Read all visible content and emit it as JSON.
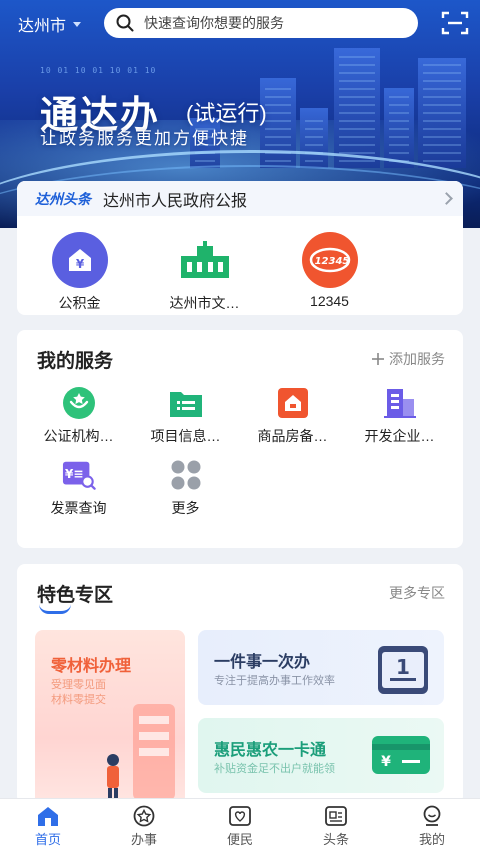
{
  "header": {
    "city": "达州市",
    "search_placeholder": "快速查询你想要的服务"
  },
  "banner": {
    "title": "通达办",
    "title_suffix": "(试运行)",
    "subtitle": "让政务服务更加方便快捷",
    "digits": "10 01 10 01 10 01 10"
  },
  "headline": {
    "tag": "达州头条",
    "text": "达州市人民政府公报"
  },
  "quick_items": [
    {
      "label": "公积金",
      "icon": "housing-fund-icon",
      "color": "#5a5fe0"
    },
    {
      "label": "达州市文…",
      "icon": "building-icon",
      "color": "#1fb36b"
    },
    {
      "label": "12345",
      "icon": "hotline-12345-icon",
      "color": "#f0552f"
    }
  ],
  "my_services": {
    "title": "我的服务",
    "add_label": "添加服务",
    "items": [
      {
        "label": "公证机构…",
        "icon": "notary-icon"
      },
      {
        "label": "项目信息…",
        "icon": "project-folder-icon"
      },
      {
        "label": "商品房备…",
        "icon": "house-record-icon"
      },
      {
        "label": "开发企业…",
        "icon": "enterprise-building-icon"
      },
      {
        "label": "发票查询",
        "icon": "invoice-search-icon"
      },
      {
        "label": "更多",
        "icon": "more-dots-icon"
      }
    ]
  },
  "special_zone": {
    "title": "特色专区",
    "more_label": "更多专区",
    "tile_a": {
      "title": "零材料办理",
      "sub1": "受理零见面",
      "sub2": "材料零提交"
    },
    "tile_b": {
      "title": "一件事一次办",
      "sub": "专注于提高办事工作效率",
      "badge": "1"
    },
    "tile_c": {
      "title": "惠民惠农一卡通",
      "sub": "补贴资金足不出户就能领",
      "symbol": "¥"
    }
  },
  "tabs": [
    {
      "label": "首页",
      "icon": "home-icon",
      "active": true
    },
    {
      "label": "办事",
      "icon": "star-badge-icon",
      "active": false
    },
    {
      "label": "便民",
      "icon": "heart-icon",
      "active": false
    },
    {
      "label": "头条",
      "icon": "news-icon",
      "active": false
    },
    {
      "label": "我的",
      "icon": "profile-icon",
      "active": false
    }
  ],
  "colors": {
    "accent": "#2f6ee8",
    "banner": "#1a3fa8"
  }
}
